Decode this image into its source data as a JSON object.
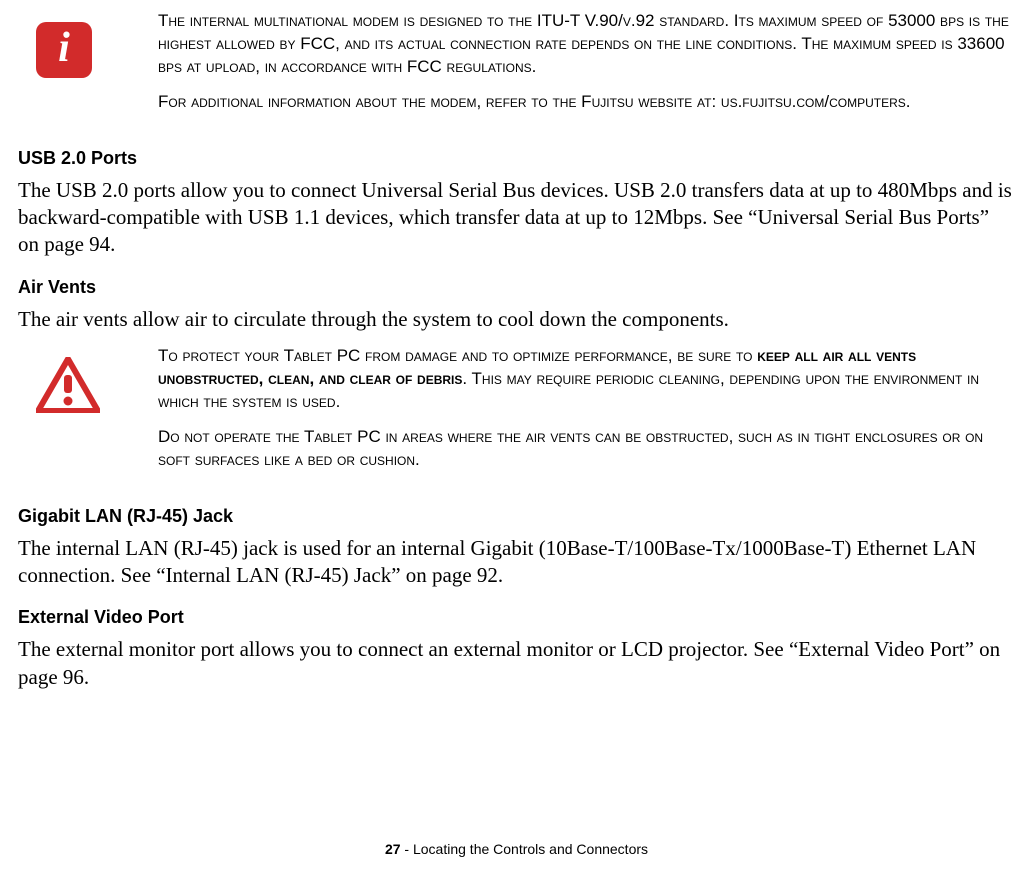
{
  "callout1": {
    "p1": "The internal multinational modem is designed to the ITU-T V.90/v.92 standard. Its maximum speed of 53000 bps is the highest allowed by FCC, and its actual connection rate depends on the line conditions. The maximum speed is 33600 bps at upload, in accordance with FCC regulations.",
    "p2": "For additional information about the modem, refer to the Fujitsu website at: us.fujitsu.com/computers."
  },
  "sec1": {
    "heading": "USB 2.0 Ports",
    "body": "The USB 2.0 ports allow you to connect Universal Serial Bus devices. USB 2.0 transfers data at up to 480Mbps and is backward-compatible with USB 1.1 devices, which transfer data at up to 12Mbps. See “Universal Serial Bus Ports” on page 94."
  },
  "sec2": {
    "heading": "Air Vents",
    "body": "The air vents allow air to circulate through the system to cool down the components."
  },
  "callout2": {
    "p1_a": "To protect your Tablet PC from damage and to optimize performance, be sure to ",
    "p1_b": "keep all air all vents unobstructed, clean, and clear of debris",
    "p1_c": ". This may require periodic cleaning, depending upon the environment in which the system is used.",
    "p2": "Do not operate the Tablet PC in areas where the air vents can be obstructed, such as in tight enclosures or on soft surfaces like a bed or cushion."
  },
  "sec3": {
    "heading": "Gigabit LAN (RJ-45) Jack",
    "body": "The internal LAN (RJ-45) jack is used for an internal Gigabit (10Base-T/100Base-Tx/1000Base-T) Ethernet LAN connection. See “Internal LAN (RJ-45) Jack” on page 92."
  },
  "sec4": {
    "heading": "External Video Port",
    "body": "The external monitor port allows you to connect an external monitor or LCD projector. See “External Video Port” on page 96."
  },
  "footer": {
    "pagenum": "27",
    "sep": " - ",
    "title": "Locating the Controls and Connectors"
  }
}
